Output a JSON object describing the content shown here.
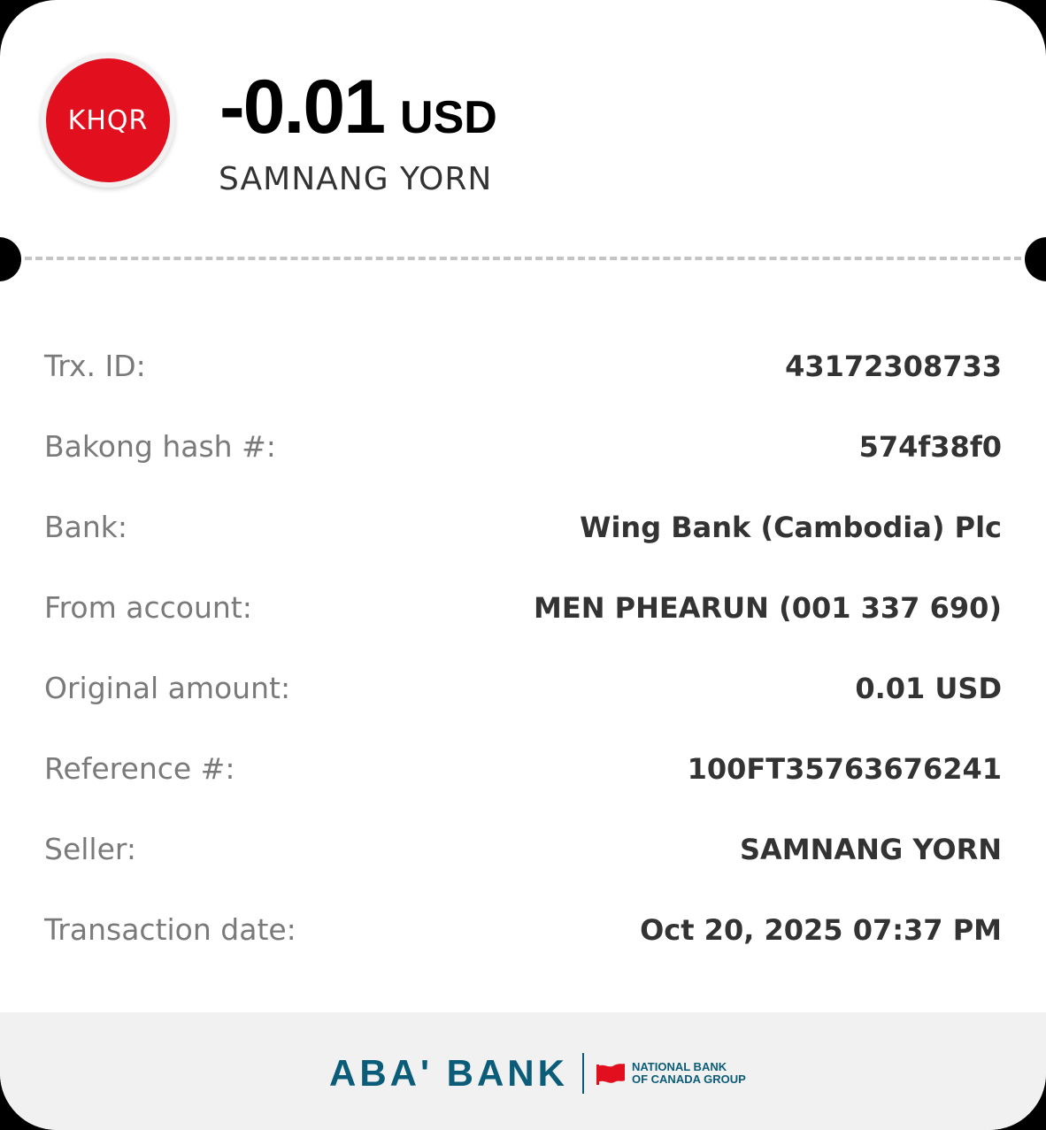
{
  "header": {
    "logo_text": "KHQR",
    "amount": "-0.01",
    "currency": "USD",
    "payee_name": "SAMNANG YORN"
  },
  "details": [
    {
      "label": "Trx. ID:",
      "value": "43172308733"
    },
    {
      "label": "Bakong hash #:",
      "value": "574f38f0"
    },
    {
      "label": "Bank:",
      "value": "Wing Bank (Cambodia) Plc"
    },
    {
      "label": "From account:",
      "value": "MEN PHEARUN (001 337 690)"
    },
    {
      "label": "Original amount:",
      "value": "0.01 USD"
    },
    {
      "label": "Reference #:",
      "value": "100FT35763676241"
    },
    {
      "label": "Seller:",
      "value": "SAMNANG YORN"
    },
    {
      "label": "Transaction date:",
      "value": "Oct 20, 2025 07:37 PM"
    }
  ],
  "footer": {
    "brand_name": "ABA' BANK",
    "group_line1": "NATIONAL BANK",
    "group_line2": "OF CANADA GROUP",
    "brand_color": "#0b5c78",
    "flag_color": "#e2101e"
  },
  "colors": {
    "logo_red": "#e2101e",
    "label_gray": "#7a7a7a",
    "value_dark": "#333333",
    "footer_bg": "#f1f1f1"
  }
}
